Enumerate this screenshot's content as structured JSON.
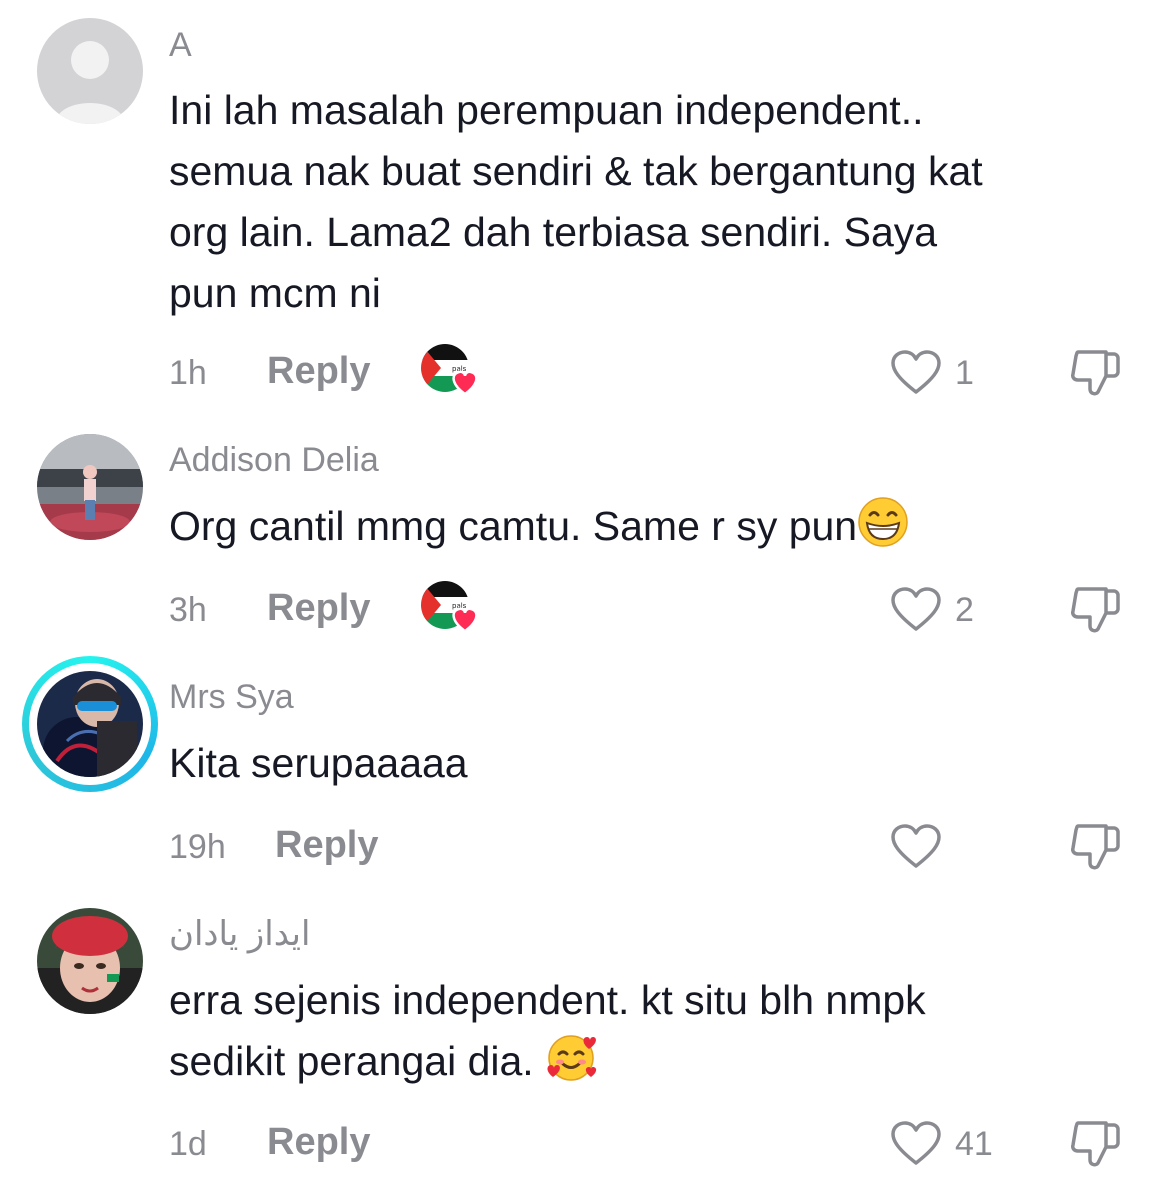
{
  "comments": [
    {
      "username": "A",
      "text_lines": [
        "Ini lah masalah perempuan independent..",
        "semua nak buat sendiri & tak bergantung kat",
        "org lain. Lama2 dah terbiasa sendiri. Saya",
        "pun mcm ni"
      ],
      "time": "1h",
      "reply_label": "Reply",
      "likes": "1",
      "avatar": "default-avatar-icon",
      "creator_liked": true
    },
    {
      "username": "Addison Delia",
      "text": "Org cantil mmg camtu. Same r sy pun",
      "emoji": "grinning-face-icon",
      "time": "3h",
      "reply_label": "Reply",
      "likes": "2",
      "creator_liked": true
    },
    {
      "username": "Mrs Sya",
      "text": "Kita serupaaaaa",
      "time": "19h",
      "reply_label": "Reply",
      "likes": "",
      "story_ring": true
    },
    {
      "username": "ايداز يادان",
      "text_lines": [
        "erra sejenis independent. kt situ blh nmpk",
        "sedikit perangai dia."
      ],
      "emoji": "smiling-face-with-hearts-icon",
      "time": "1d",
      "reply_label": "Reply",
      "likes": "41"
    }
  ],
  "colors": {
    "text": "#161823",
    "secondary": "#8a8b91",
    "story_ring": "#25F4EE",
    "creator_heart": "#FE2C55"
  }
}
